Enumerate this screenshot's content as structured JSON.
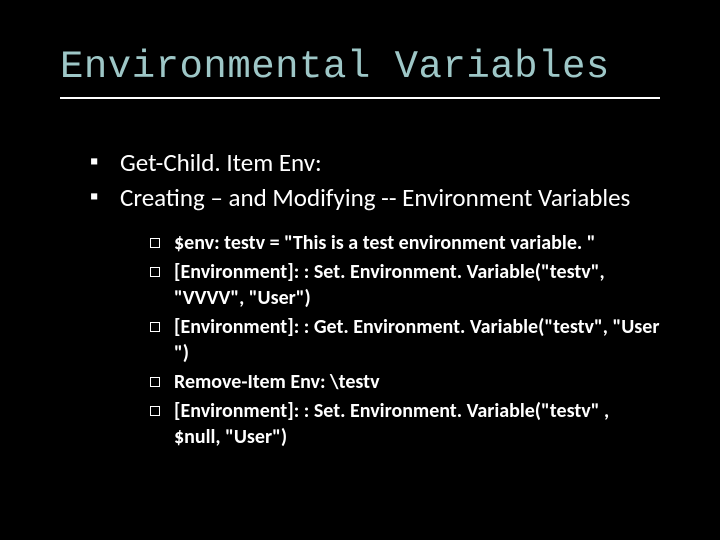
{
  "title": "Environmental Variables",
  "bullets": {
    "level1": [
      {
        "text": "Get-Child. Item Env:"
      },
      {
        "text": "Creating – and Modifying -- Environment Variables",
        "children": [
          "$env: testv = \"This is a test environment variable. \"",
          "[Environment]: : Set. Environment. Variable(\"testv\", \"VVVV\", \"User\")",
          "[Environment]: : Get. Environment. Variable(\"testv\", \"User \")",
          "Remove-Item Env: \\testv",
          "[Environment]: : Set. Environment. Variable(\"testv\" , $null, \"User\")"
        ]
      }
    ]
  }
}
